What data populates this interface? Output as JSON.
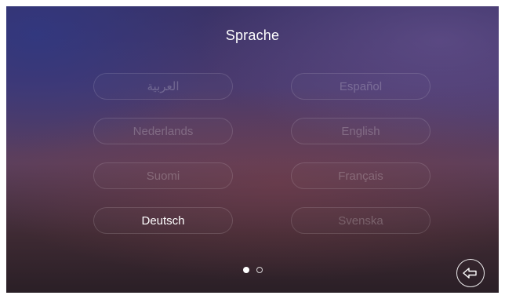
{
  "header": {
    "title": "Sprache"
  },
  "languages": [
    {
      "label": "العربية",
      "selected": false
    },
    {
      "label": "Español",
      "selected": false
    },
    {
      "label": "Nederlands",
      "selected": false
    },
    {
      "label": "English",
      "selected": false
    },
    {
      "label": "Suomi",
      "selected": false
    },
    {
      "label": "Français",
      "selected": false
    },
    {
      "label": "Deutsch",
      "selected": true
    },
    {
      "label": "Svenska",
      "selected": false
    }
  ],
  "pagination": {
    "current_page": 1,
    "total_pages": 2
  },
  "icons": {
    "back": "back-arrow-icon"
  }
}
